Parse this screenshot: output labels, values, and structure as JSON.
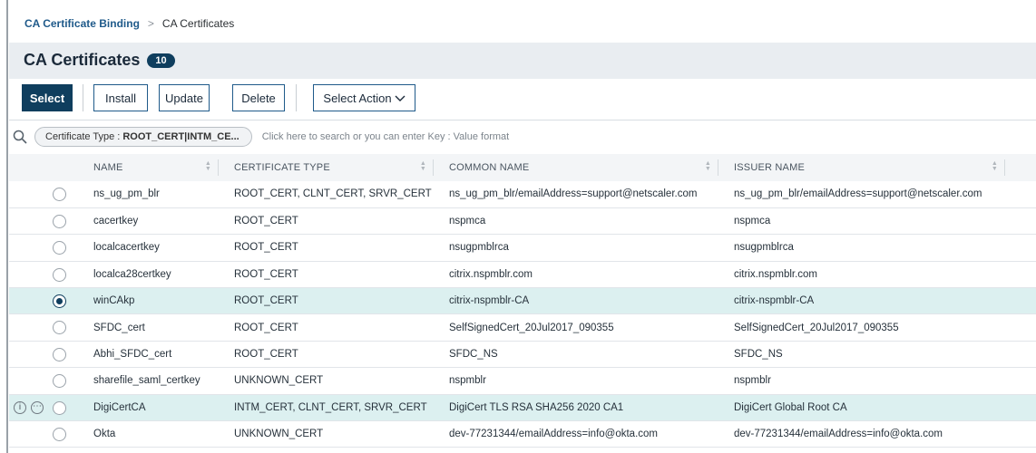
{
  "breadcrumb": {
    "parent": "CA Certificate Binding",
    "separator": ">",
    "current": "CA Certificates"
  },
  "header": {
    "title": "CA Certificates",
    "count": "10"
  },
  "toolbar": {
    "select": "Select",
    "install": "Install",
    "update": "Update",
    "delete": "Delete",
    "select_action": "Select Action"
  },
  "search": {
    "filter_key": "Certificate Type :",
    "filter_value": "ROOT_CERT|INTM_CE...",
    "placeholder": "Click here to search or you can enter Key : Value format"
  },
  "table": {
    "columns": [
      "NAME",
      "CERTIFICATE TYPE",
      "COMMON NAME",
      "ISSUER NAME"
    ],
    "rows": [
      {
        "name": "ns_ug_pm_blr",
        "type": "ROOT_CERT, CLNT_CERT, SRVR_CERT",
        "common": "ns_ug_pm_blr/emailAddress=support@netscaler.com",
        "issuer": "ns_ug_pm_blr/emailAddress=support@netscaler.com"
      },
      {
        "name": "cacertkey",
        "type": "ROOT_CERT",
        "common": "nspmca",
        "issuer": "nspmca"
      },
      {
        "name": "localcacertkey",
        "type": "ROOT_CERT",
        "common": "nsugpmblrca",
        "issuer": "nsugpmblrca"
      },
      {
        "name": "localca28certkey",
        "type": "ROOT_CERT",
        "common": "citrix.nspmblr.com",
        "issuer": "citrix.nspmblr.com"
      },
      {
        "name": "winCAkp",
        "type": "ROOT_CERT",
        "common": "citrix-nspmblr-CA",
        "issuer": "citrix-nspmblr-CA"
      },
      {
        "name": "SFDC_cert",
        "type": "ROOT_CERT",
        "common": "SelfSignedCert_20Jul2017_090355",
        "issuer": "SelfSignedCert_20Jul2017_090355"
      },
      {
        "name": "Abhi_SFDC_cert",
        "type": "ROOT_CERT",
        "common": "SFDC_NS",
        "issuer": "SFDC_NS"
      },
      {
        "name": "sharefile_saml_certkey",
        "type": "UNKNOWN_CERT",
        "common": "nspmblr",
        "issuer": "nspmblr"
      },
      {
        "name": "DigiCertCA",
        "type": "INTM_CERT, CLNT_CERT, SRVR_CERT",
        "common": "DigiCert TLS RSA SHA256 2020 CA1",
        "issuer": "DigiCert Global Root CA"
      },
      {
        "name": "Okta",
        "type": "UNKNOWN_CERT",
        "common": "dev-77231344/emailAddress=info@okta.com",
        "issuer": "dev-77231344/emailAddress=info@okta.com"
      }
    ]
  },
  "row_icons": {
    "info": "i",
    "more": "⋯"
  },
  "colors": {
    "primary": "#0f3e5e",
    "link": "#1f5a8a",
    "selected_row": "#dcf0f0",
    "header_bg": "#e9edf1"
  }
}
